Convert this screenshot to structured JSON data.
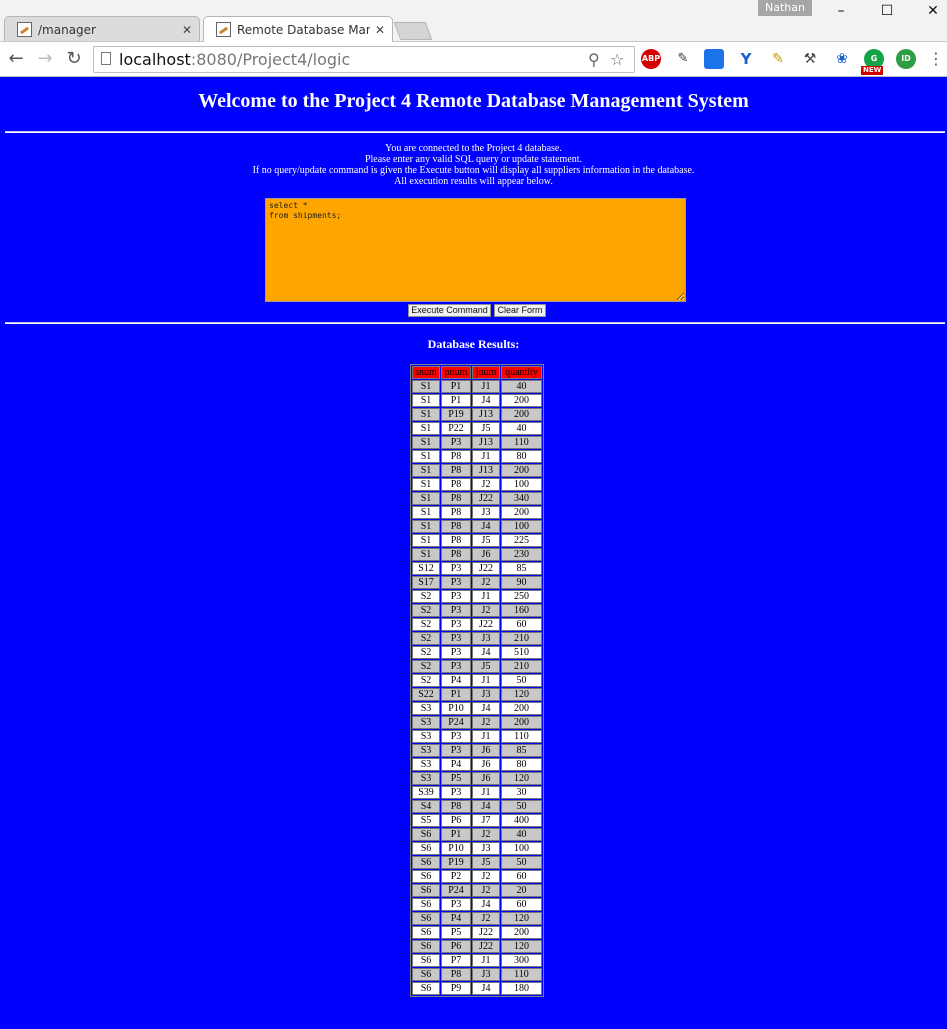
{
  "browser": {
    "profile_name": "Nathan",
    "tabs": [
      {
        "title": "/manager",
        "active": false
      },
      {
        "title": "Remote Database Manage",
        "active": true
      }
    ],
    "url_host": "localhost",
    "url_path": ":8080/Project4/logic",
    "extensions": [
      "adblock-icon",
      "cookie-icon",
      "screen-icon",
      "vpn-icon",
      "broom-icon",
      "pickaxe-icon",
      "bug-icon",
      "grammarly-icon",
      "id-icon"
    ],
    "new_badge": "NEW"
  },
  "page": {
    "title": "Welcome to the Project 4 Remote Database Management System",
    "intro_lines": [
      "You are connected to the Project 4 database.",
      "Please enter any valid SQL query or update statement.",
      "If no query/update command is given the Execute button will display all suppliers information in the database.",
      "All execution results will appear below."
    ],
    "sql_text": "select *\nfrom shipments;",
    "execute_label": "Execute Command",
    "clear_label": "Clear Form",
    "results_heading": "Database Results:",
    "colors": {
      "background": "#0000ff",
      "textarea": "#ffa500",
      "header_row": "#ff0000",
      "odd_row": "#c8c8c8",
      "even_row": "#ffffff"
    }
  },
  "results": {
    "columns": [
      "snum",
      "pnum",
      "jnum",
      "quantity"
    ],
    "rows": [
      [
        "S1",
        "P1",
        "J1",
        "40"
      ],
      [
        "S1",
        "P1",
        "J4",
        "200"
      ],
      [
        "S1",
        "P19",
        "J13",
        "200"
      ],
      [
        "S1",
        "P22",
        "J5",
        "40"
      ],
      [
        "S1",
        "P3",
        "J13",
        "110"
      ],
      [
        "S1",
        "P8",
        "J1",
        "80"
      ],
      [
        "S1",
        "P8",
        "J13",
        "200"
      ],
      [
        "S1",
        "P8",
        "J2",
        "100"
      ],
      [
        "S1",
        "P8",
        "J22",
        "340"
      ],
      [
        "S1",
        "P8",
        "J3",
        "200"
      ],
      [
        "S1",
        "P8",
        "J4",
        "100"
      ],
      [
        "S1",
        "P8",
        "J5",
        "225"
      ],
      [
        "S1",
        "P8",
        "J6",
        "230"
      ],
      [
        "S12",
        "P3",
        "J22",
        "85"
      ],
      [
        "S17",
        "P3",
        "J2",
        "90"
      ],
      [
        "S2",
        "P3",
        "J1",
        "250"
      ],
      [
        "S2",
        "P3",
        "J2",
        "160"
      ],
      [
        "S2",
        "P3",
        "J22",
        "60"
      ],
      [
        "S2",
        "P3",
        "J3",
        "210"
      ],
      [
        "S2",
        "P3",
        "J4",
        "510"
      ],
      [
        "S2",
        "P3",
        "J5",
        "210"
      ],
      [
        "S2",
        "P4",
        "J1",
        "50"
      ],
      [
        "S22",
        "P1",
        "J3",
        "120"
      ],
      [
        "S3",
        "P10",
        "J4",
        "200"
      ],
      [
        "S3",
        "P24",
        "J2",
        "200"
      ],
      [
        "S3",
        "P3",
        "J1",
        "110"
      ],
      [
        "S3",
        "P3",
        "J6",
        "85"
      ],
      [
        "S3",
        "P4",
        "J6",
        "80"
      ],
      [
        "S3",
        "P5",
        "J6",
        "120"
      ],
      [
        "S39",
        "P3",
        "J1",
        "30"
      ],
      [
        "S4",
        "P8",
        "J4",
        "50"
      ],
      [
        "S5",
        "P6",
        "J7",
        "400"
      ],
      [
        "S6",
        "P1",
        "J2",
        "40"
      ],
      [
        "S6",
        "P10",
        "J3",
        "100"
      ],
      [
        "S6",
        "P19",
        "J5",
        "50"
      ],
      [
        "S6",
        "P2",
        "J2",
        "60"
      ],
      [
        "S6",
        "P24",
        "J2",
        "20"
      ],
      [
        "S6",
        "P3",
        "J4",
        "60"
      ],
      [
        "S6",
        "P4",
        "J2",
        "120"
      ],
      [
        "S6",
        "P5",
        "J22",
        "200"
      ],
      [
        "S6",
        "P6",
        "J22",
        "120"
      ],
      [
        "S6",
        "P7",
        "J1",
        "300"
      ],
      [
        "S6",
        "P8",
        "J3",
        "110"
      ],
      [
        "S6",
        "P9",
        "J4",
        "180"
      ]
    ]
  }
}
